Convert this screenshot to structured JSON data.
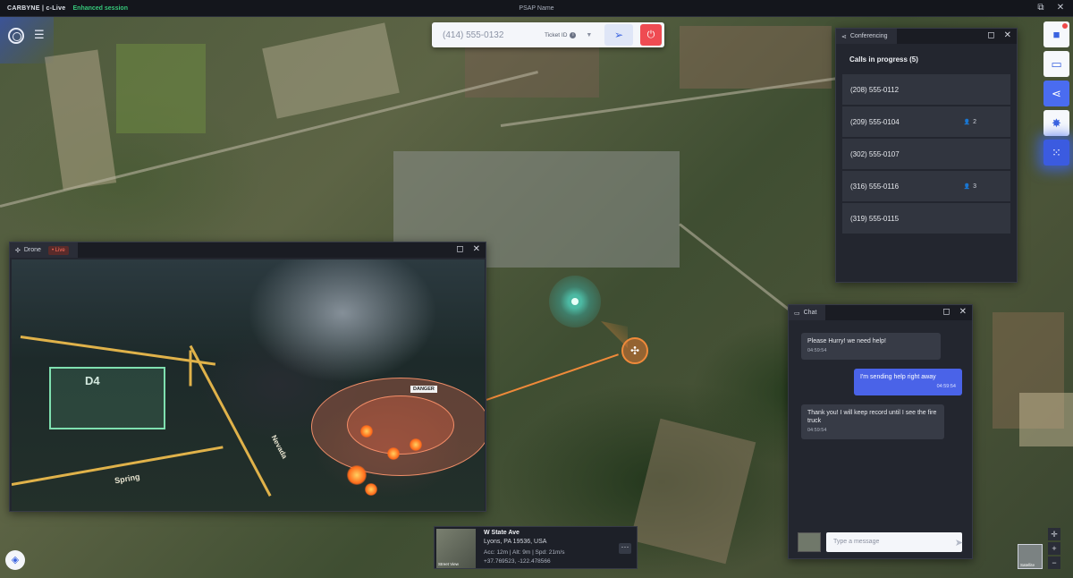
{
  "topbar": {
    "brand": "CARBYNE | c-Live",
    "session": "Enhanced session",
    "psap": "PSAP Name"
  },
  "dispatch": {
    "phone": "(414) 555-0132",
    "ticket_label": "Ticket ID"
  },
  "conferencing": {
    "tab": "Conferencing",
    "title": "Calls in progress (5)",
    "calls": [
      {
        "number": "(208) 555-0112",
        "count": ""
      },
      {
        "number": "(209) 555-0104",
        "count": "2"
      },
      {
        "number": "(302) 555-0107",
        "count": ""
      },
      {
        "number": "(316) 555-0116",
        "count": "3"
      },
      {
        "number": "(319) 555-0115",
        "count": ""
      }
    ]
  },
  "drone": {
    "tab": "Drone",
    "live": "• Live",
    "zone_label": "D4",
    "danger_label": "DANGER",
    "street1": "Spring",
    "street2": "Nevada"
  },
  "chat": {
    "tab": "Chat",
    "messages": [
      {
        "text": "Please Hurry! we need help!",
        "time": "04:59:54",
        "dir": "in"
      },
      {
        "text": "I'm sending help right away",
        "time": "04:59:54",
        "dir": "out"
      },
      {
        "text": "Thank you! I will keep record until I see the fire truck",
        "time": "04:59:54",
        "dir": "in"
      }
    ],
    "placeholder": "Type a message"
  },
  "address": {
    "street": "W State Ave",
    "city": "Lyons, PA 19536, USA",
    "metrics": "Acc: 12m  |  Alt: 9m  |  Spd: 21m/s",
    "coords": "+37.769523, -122.478566",
    "thumb_label": "Street View"
  },
  "map": {
    "satellite_label": "Satellite"
  },
  "icons": {
    "target": "target-icon",
    "list": "list-icon",
    "video": "video-icon",
    "chat": "chat-icon",
    "share": "share-icon",
    "hex": "hex-icon",
    "nodes": "nodes-icon",
    "layers": "layers-icon"
  },
  "colors": {
    "accent": "#4a6cf0",
    "live": "#36c77a",
    "danger": "#ef4b52",
    "drone": "#f08a3a"
  }
}
